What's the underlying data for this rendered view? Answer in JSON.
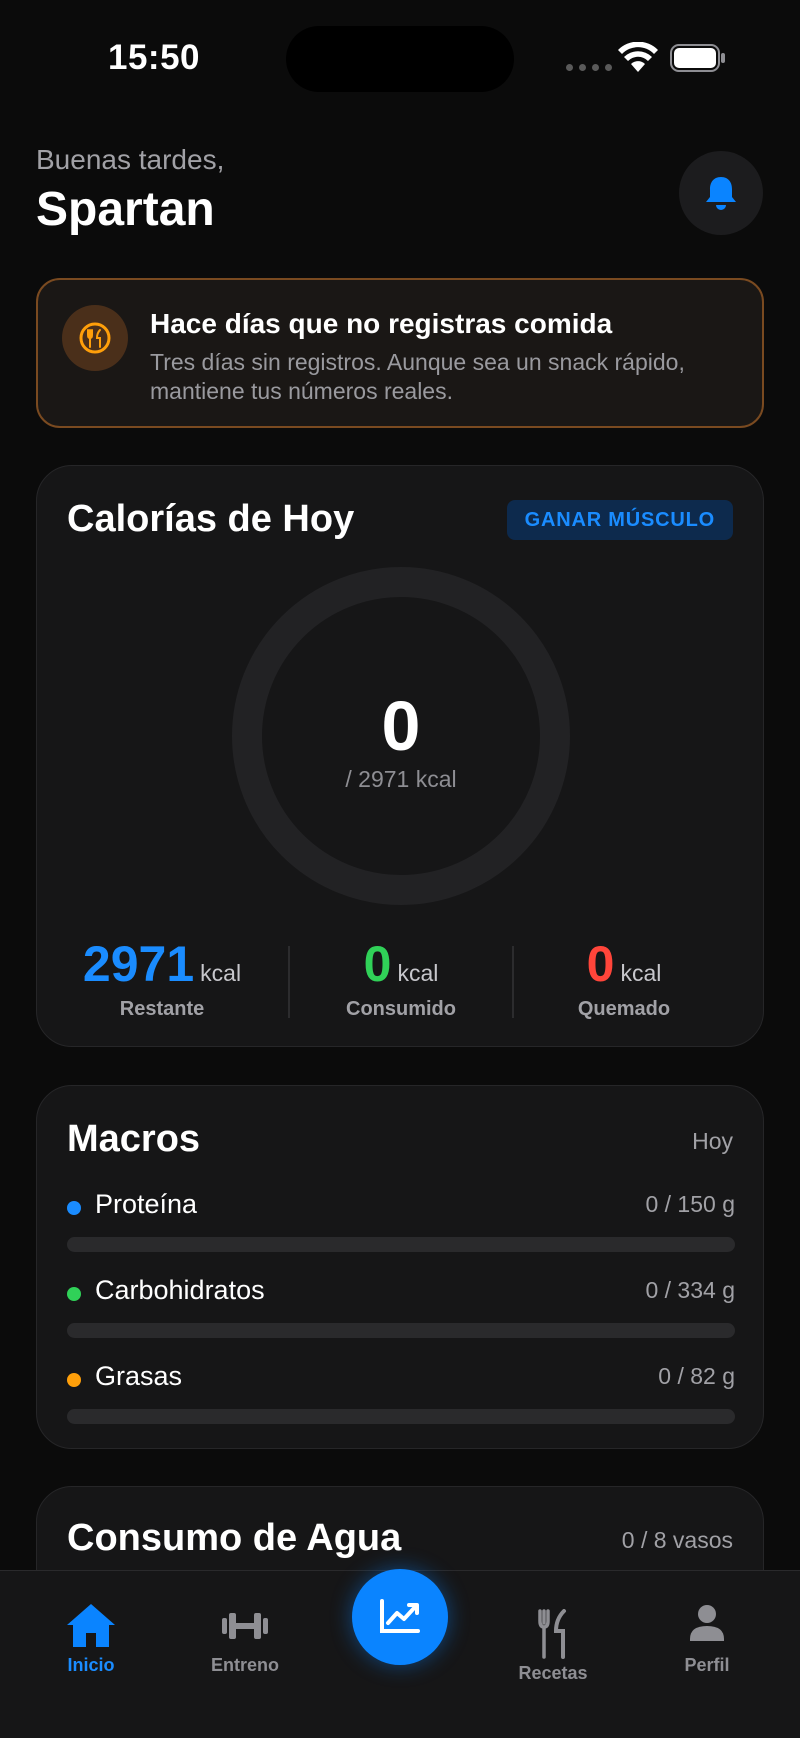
{
  "status_bar": {
    "time": "15:50"
  },
  "header": {
    "greeting": "Buenas tardes,",
    "user_name": "Spartan"
  },
  "alert": {
    "title": "Hace días que no registras comida",
    "body": "Tres días sin registros. Aunque sea un snack rápido, mantiene tus números reales."
  },
  "calories": {
    "title": "Calorías de Hoy",
    "goal_badge": "GANAR MÚSCULO",
    "consumed_value": "0",
    "target_label": "/ 2971 kcal",
    "progress_fraction": 0,
    "stats": [
      {
        "value": "2971",
        "unit": "kcal",
        "label": "Restante",
        "color": "#1a8cff"
      },
      {
        "value": "0",
        "unit": "kcal",
        "label": "Consumido",
        "color": "#30d158"
      },
      {
        "value": "0",
        "unit": "kcal",
        "label": "Quemado",
        "color": "#ff453a"
      }
    ]
  },
  "macros": {
    "title": "Macros",
    "period": "Hoy",
    "items": [
      {
        "name": "Proteína",
        "amount": "0 / 150 g",
        "color": "#1a8cff",
        "progress_fraction": 0
      },
      {
        "name": "Carbohidratos",
        "amount": "0 / 334 g",
        "color": "#30d158",
        "progress_fraction": 0
      },
      {
        "name": "Grasas",
        "amount": "0 / 82 g",
        "color": "#ff9f0a",
        "progress_fraction": 0
      }
    ]
  },
  "water": {
    "title": "Consumo de Agua",
    "count": "0 / 8 vasos"
  },
  "tab_bar": {
    "tabs": [
      {
        "label": "Inicio",
        "icon": "house-icon",
        "active": true
      },
      {
        "label": "Entreno",
        "icon": "dumbbell-icon",
        "active": false
      },
      {
        "label": "Recetas",
        "icon": "fork-knife-icon",
        "active": false
      },
      {
        "label": "Perfil",
        "icon": "person-icon",
        "active": false
      }
    ],
    "fab_icon": "chart-trend-icon"
  },
  "colors": {
    "accent": "#0a84ff",
    "alert_border": "#7a4a20",
    "alert_icon": "#ff9f0a"
  }
}
